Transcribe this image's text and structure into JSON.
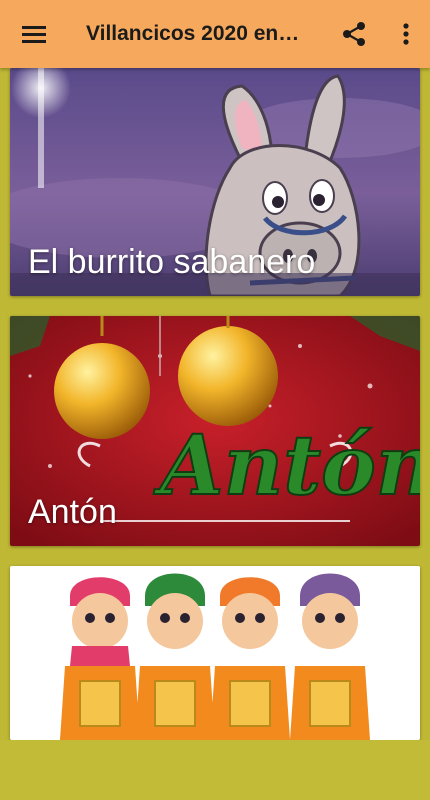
{
  "app_bar": {
    "title": "Villancicos 2020 en…",
    "menu_icon": "hamburger-menu-icon",
    "share_icon": "share-icon",
    "more_icon": "more-vert-icon",
    "background_color": "#f6a95c"
  },
  "songs": [
    {
      "label": "El burrito sabanero",
      "image": "donkey-illustration"
    },
    {
      "label": "Antón",
      "image": "anton-christmas-ornaments",
      "image_text": "Antón"
    },
    {
      "label": "",
      "image": "caroling-children-illustration"
    }
  ],
  "colors": {
    "page_background": "#bfb834",
    "card_label_text": "#ffffff"
  }
}
